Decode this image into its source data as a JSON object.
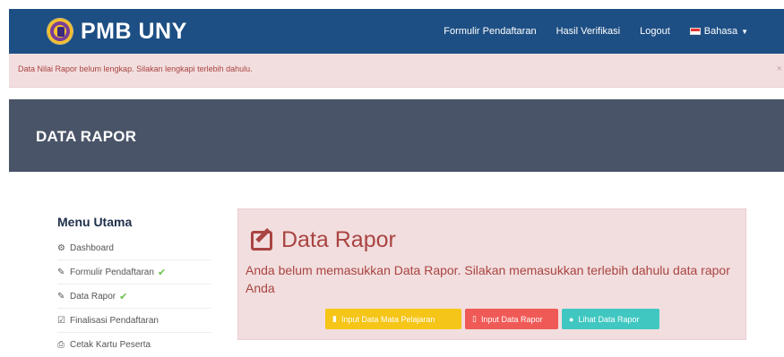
{
  "header": {
    "brand": "PMB UNY",
    "nav": [
      {
        "label": "Formulir Pendaftaran"
      },
      {
        "label": "Hasil Verifikasi"
      },
      {
        "label": "Logout"
      },
      {
        "label": "Bahasa"
      }
    ]
  },
  "alert": {
    "text": "Data Nilai Rapor belum lengkap. Silakan lengkapi terlebih dahulu.",
    "close": "×"
  },
  "page": {
    "title": "DATA RAPOR"
  },
  "sidebar": {
    "title": "Menu Utama",
    "items": [
      {
        "label": "Dashboard",
        "icon": "dashboard-icon",
        "done": false
      },
      {
        "label": "Formulir Pendaftaran",
        "icon": "edit-icon",
        "done": true
      },
      {
        "label": "Data Rapor",
        "icon": "edit-icon",
        "done": true
      },
      {
        "label": "Finalisasi Pendaftaran",
        "icon": "check-square-icon",
        "done": false
      },
      {
        "label": "Cetak Kartu Peserta",
        "icon": "print-icon",
        "done": false
      }
    ]
  },
  "panel": {
    "title": "Data Rapor",
    "message": "Anda belum memasukkan Data Rapor. Silakan memasukkan terlebih dahulu data rapor Anda",
    "buttons": [
      {
        "label": "Input Data Mata Pelajaran",
        "color": "#f5c518"
      },
      {
        "label": "Input Data Rapor",
        "color": "#f05a56"
      },
      {
        "label": "Lihat Data Rapor",
        "color": "#41c7c1"
      }
    ]
  },
  "colors": {
    "navbar": "#1e4f84",
    "alert_bg": "#f2dede",
    "alert_text": "#a94442",
    "header_bg": "#4a5468",
    "success": "#6cc04a"
  }
}
